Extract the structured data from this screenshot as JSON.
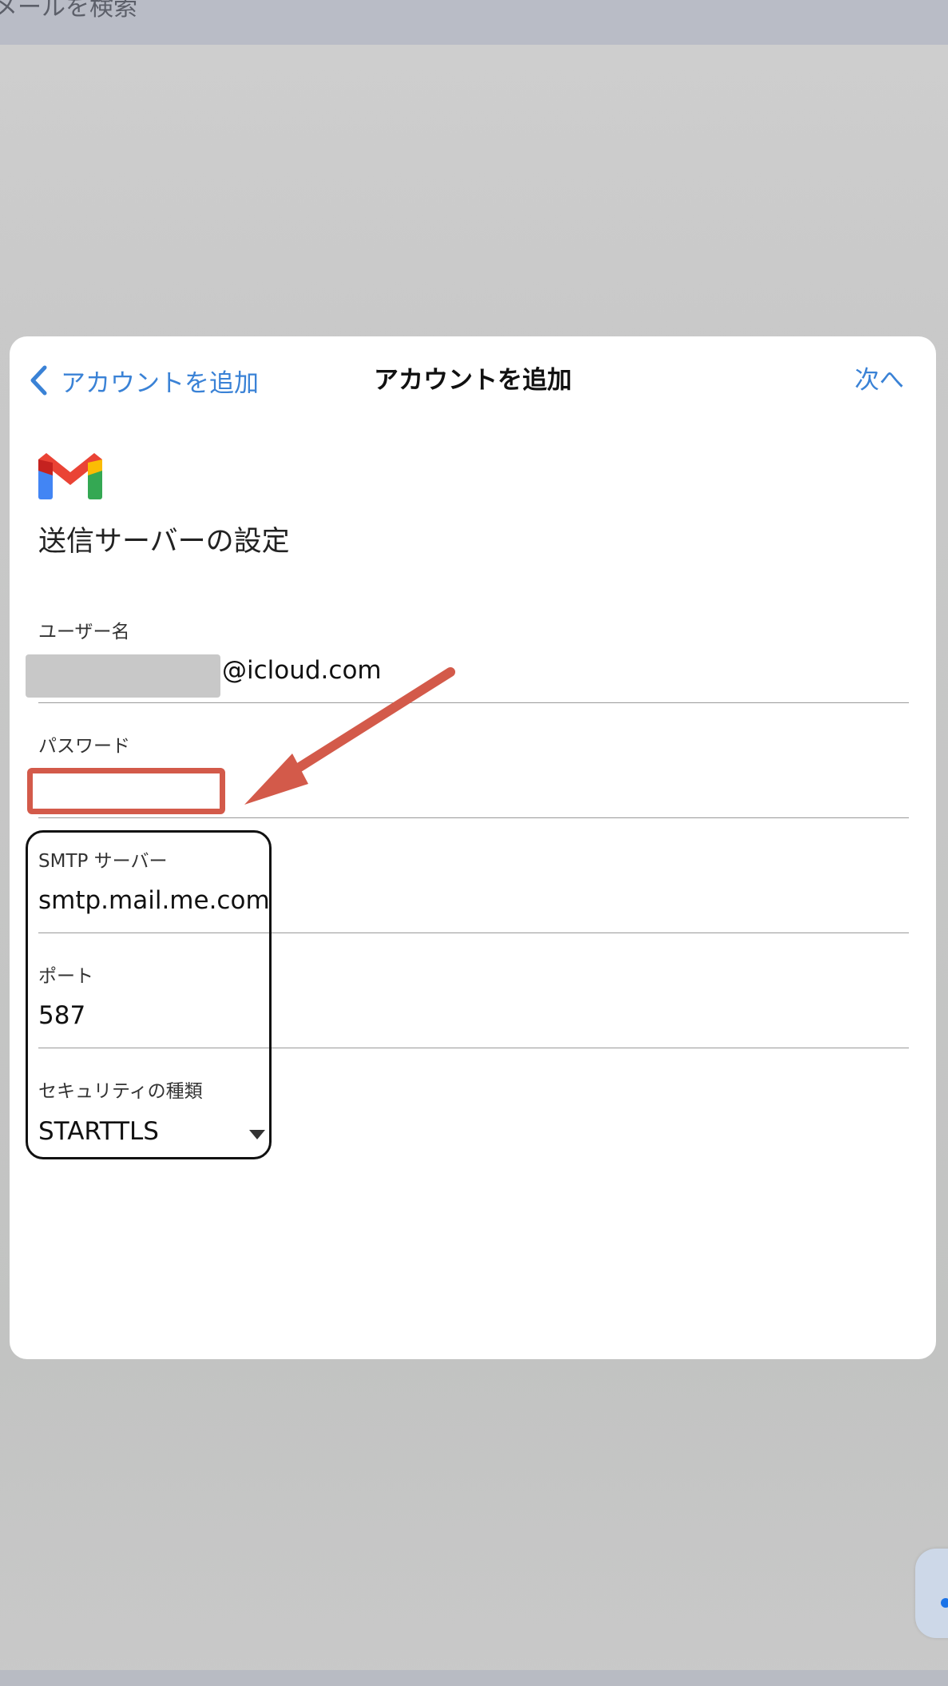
{
  "background": {
    "search_hint": "メールを検索"
  },
  "nav": {
    "back_label": "アカウントを追加",
    "title": "アカウントを追加",
    "next_label": "次へ"
  },
  "section_title": "送信サーバーの設定",
  "fields": {
    "username": {
      "label": "ユーザー名",
      "value_suffix": "@icloud.com"
    },
    "password": {
      "label": "パスワード",
      "value": ""
    },
    "smtp_server": {
      "label": "SMTP サーバー",
      "value": "smtp.mail.me.com"
    },
    "port": {
      "label": "ポート",
      "value": "587"
    },
    "security": {
      "label": "セキュリティの種類",
      "value": "STARTTLS"
    }
  },
  "colors": {
    "accent": "#3a82d6",
    "annotation_red": "#d35a4a",
    "annotation_black": "#111111"
  },
  "icons": [
    "chevron-left-icon",
    "gmail-icon",
    "dropdown-caret-icon"
  ]
}
